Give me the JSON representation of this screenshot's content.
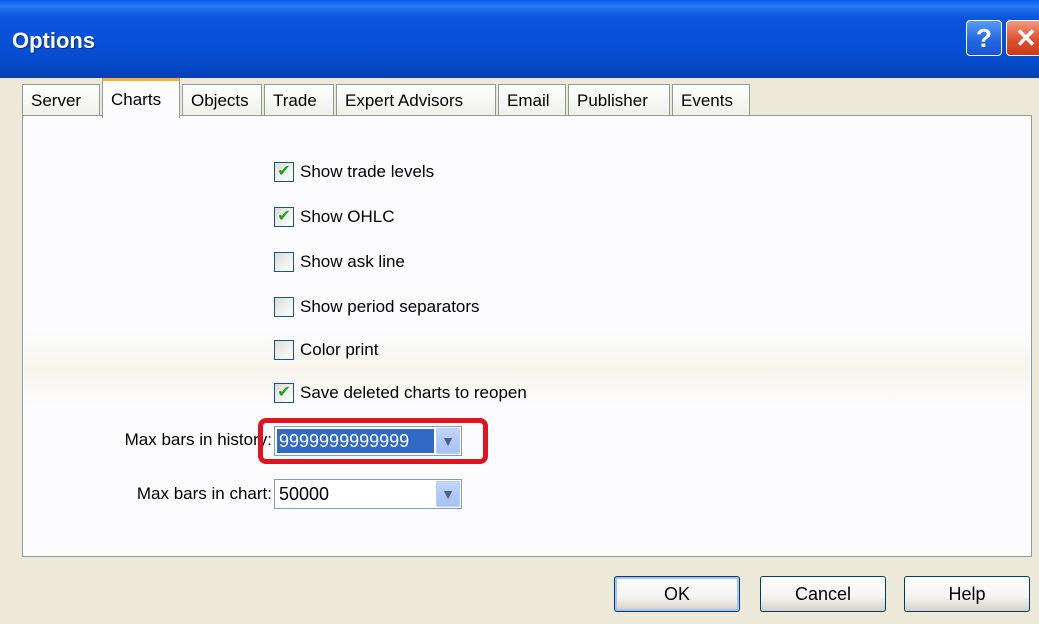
{
  "window": {
    "title": "Options",
    "help_glyph": "?",
    "close_glyph": "✕"
  },
  "tabs": [
    {
      "label": "Server"
    },
    {
      "label": "Charts",
      "active": true
    },
    {
      "label": "Objects"
    },
    {
      "label": "Trade"
    },
    {
      "label": "Expert Advisors"
    },
    {
      "label": "Email"
    },
    {
      "label": "Publisher"
    },
    {
      "label": "Events"
    }
  ],
  "checkboxes": [
    {
      "label": "Show trade levels",
      "checked": true,
      "mark": "✔"
    },
    {
      "label": "Show OHLC",
      "checked": true,
      "mark": "✔"
    },
    {
      "label": "Show ask line",
      "checked": false,
      "mark": ""
    },
    {
      "label": "Show period separators",
      "checked": false,
      "mark": ""
    },
    {
      "label": "Color print",
      "checked": false,
      "mark": ""
    },
    {
      "label": "Save deleted charts to reopen",
      "checked": true,
      "mark": "✔"
    }
  ],
  "fields": {
    "max_bars_history": {
      "label": "Max bars in history:",
      "value": "9999999999999"
    },
    "max_bars_chart": {
      "label": "Max bars in chart:",
      "value": "50000"
    }
  },
  "buttons": {
    "ok": "OK",
    "cancel": "Cancel",
    "help": "Help"
  },
  "icons": {
    "dropdown": "chevron-down-icon",
    "checkmark": "checkmark-icon"
  },
  "colors": {
    "titlebar": "#0650d6",
    "highlight": "#e0141e",
    "selection": "#316ac5",
    "check": "#21a121"
  }
}
